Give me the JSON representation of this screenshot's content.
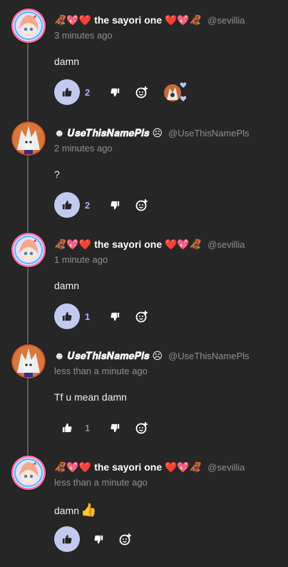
{
  "comments": [
    {
      "name_prefix": "🦧💖❤️",
      "name": "the sayori one",
      "name_suffix": "❤️💖🦧",
      "handle": "@sevillia",
      "time": "3 minutes ago",
      "text": "damn",
      "likes": "2"
    },
    {
      "name_prefix": "☻",
      "name": "𝑼𝒔𝒆𝑻𝒉𝒊𝒔𝑵𝒂𝒎𝒆𝑷𝒍𝒔",
      "name_suffix": "☹",
      "handle": "@UseThisNamePls",
      "time": "2 minutes ago",
      "text": "?",
      "likes": "2"
    },
    {
      "name_prefix": "🦧💖❤️",
      "name": "the sayori one",
      "name_suffix": "❤️💖🦧",
      "handle": "@sevillia",
      "time": "1 minute ago",
      "text": "damn",
      "likes": "1"
    },
    {
      "name_prefix": "☻",
      "name": "𝑼𝒔𝒆𝑻𝒉𝒊𝒔𝑵𝒂𝒎𝒆𝑷𝒍𝒔",
      "name_suffix": "☹",
      "handle": "@UseThisNamePls",
      "time": "less than a minute ago",
      "text": "Tf u mean damn",
      "likes": "1"
    },
    {
      "name_prefix": "🦧💖❤️",
      "name": "the sayori one",
      "name_suffix": "❤️💖🦧",
      "handle": "@sevillia",
      "time": "less than a minute ago",
      "text": "damn",
      "text_emoji": "👍"
    }
  ],
  "colors": {
    "background": "#262626",
    "like_active_bg": "#c3caef",
    "like_count": "#a8b4ef",
    "muted_text": "#8f8f8f"
  },
  "icons": {
    "like": "thumbs-up-icon",
    "dislike": "thumbs-down-icon",
    "add_reaction": "add-reaction-icon"
  }
}
